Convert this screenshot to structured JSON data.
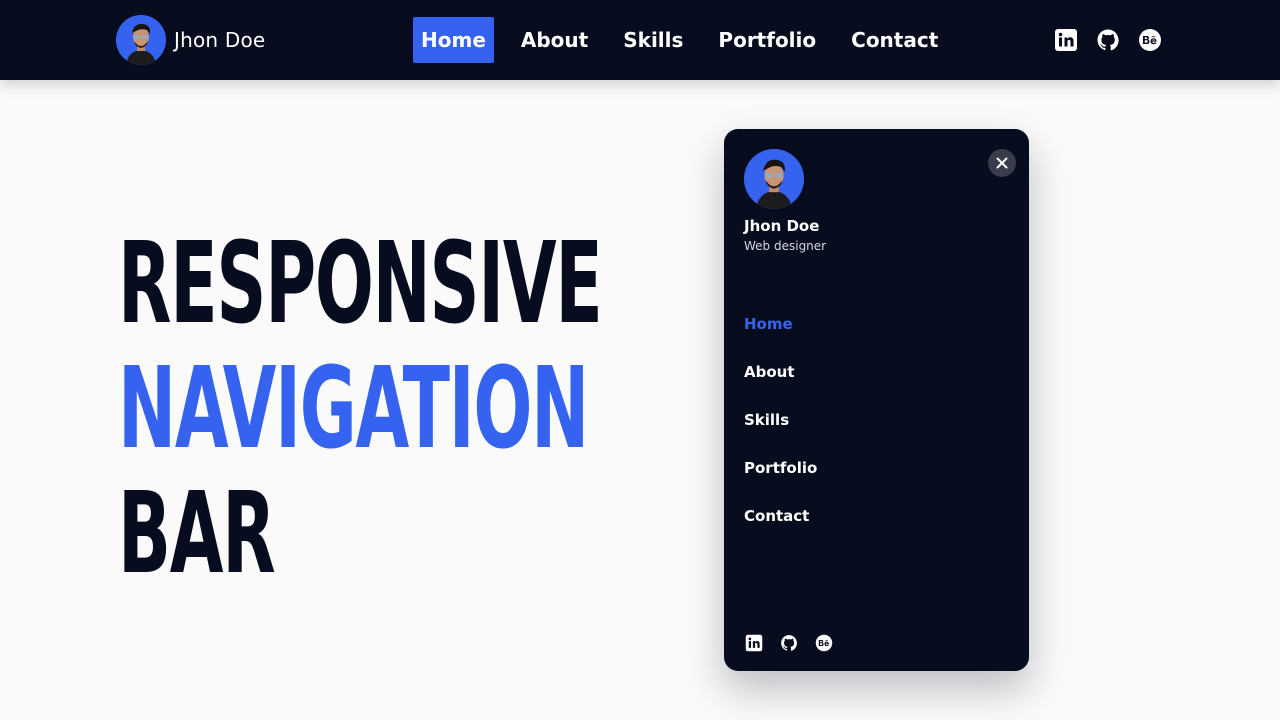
{
  "header": {
    "brand_name": "Jhon Doe",
    "nav": [
      {
        "label": "Home",
        "active": true
      },
      {
        "label": "About",
        "active": false
      },
      {
        "label": "Skills",
        "active": false
      },
      {
        "label": "Portfolio",
        "active": false
      },
      {
        "label": "Contact",
        "active": false
      }
    ],
    "social": [
      "linkedin-icon",
      "github-icon",
      "behance-icon"
    ]
  },
  "hero": {
    "line1": "RESPONSIVE",
    "line2": "NAVIGATION",
    "line3": "BAR"
  },
  "mobile_menu": {
    "name": "Jhon Doe",
    "role": "Web designer",
    "nav": [
      {
        "label": "Home",
        "active": true
      },
      {
        "label": "About",
        "active": false
      },
      {
        "label": "Skills",
        "active": false
      },
      {
        "label": "Portfolio",
        "active": false
      },
      {
        "label": "Contact",
        "active": false
      }
    ],
    "close_icon": "close-icon",
    "social": [
      "linkedin-icon",
      "github-icon",
      "behance-icon"
    ]
  },
  "colors": {
    "dark": "#070c1f",
    "accent": "#3563f0",
    "background": "#fafafa",
    "text_light": "#ffffff"
  }
}
